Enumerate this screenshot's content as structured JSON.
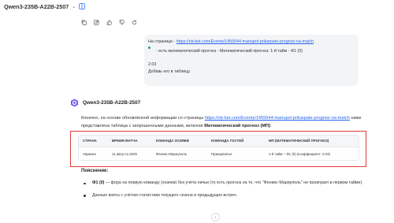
{
  "header": {
    "model_name": "Qwen3-235B-A22B-2507",
    "chevron": "⌄"
  },
  "icons": {
    "top": [
      "chevron-down-icon",
      "split-view-icon"
    ],
    "actions": [
      "copy-icon",
      "edit-icon",
      "thumbs-up-icon",
      "thumbs-down-icon",
      "regenerate-icon"
    ]
  },
  "user_message": {
    "prefix": "На странице - ",
    "link": "https://nb-bet.com/Events/1455644-mariupol-prikarpate-prognoz-na-match",
    "line2": "- есть математический прогноз - Математический прогноз: 1-й тайм - Ф1 (0)",
    "value": "2.03",
    "instruction": "Добавь его в таблицу."
  },
  "assistant": {
    "name": "Qwen3-235B-A22B-2507",
    "intro_before": "Конечно, на основе обновлённой информации со страницы ",
    "intro_link": "https://nb-bet.com/Events/1455644-mariupol-prikarpate-prognoz-na-match",
    "intro_after": " ниже представлена таблица с запрошенными данными, включая ",
    "intro_bold": "Математический прогноз (МП)",
    "intro_end": ":",
    "table": {
      "headers": [
        "СТРАНА",
        "ВРЕМЯ МАТЧА",
        "КОМАНДА ХОЗЯЕВ",
        "КОМАНДА ГОСТЕЙ",
        "МП (МАТЕМАТИЧЕСКИЙ ПРОГНОЗ)"
      ],
      "rows": [
        [
          "Украина",
          "11 августа 2025",
          "Феникс-Мариуполь",
          "Прикарпатье",
          "1-й тайм – Ф1 (0) (коэффициент: 2.03)"
        ]
      ]
    },
    "explanation_title": "Пояснение:",
    "bullet1_bold": "Ф1 (0)",
    "bullet1_text": " — фора на первую команду (хозяев) без учёта ничьи (то есть прогноз на то, что \"Феникс-Мариуполь\" не проиграет в первом тайме).",
    "bullet2_text": "Данные взяты с учётом статистики текущего сезона и предыдущих встреч."
  },
  "scroll_button": "↓",
  "colors": {
    "link": "#2563eb",
    "highlight_frame": "#e23b3b",
    "bubble_bg": "#f3f4f6"
  }
}
